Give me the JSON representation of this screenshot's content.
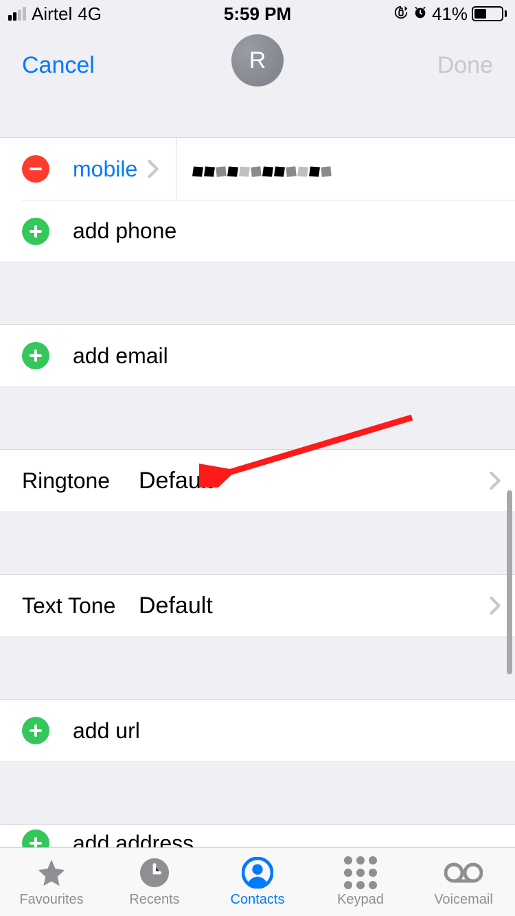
{
  "status": {
    "carrier": "Airtel",
    "network": "4G",
    "time": "5:59 PM",
    "battery_pct": "41%"
  },
  "nav": {
    "cancel": "Cancel",
    "done": "Done",
    "avatar_initial": "R"
  },
  "phone": {
    "type_label": "mobile",
    "value_redacted": ""
  },
  "actions": {
    "add_phone": "add phone",
    "add_email": "add email",
    "add_url": "add url",
    "add_address": "add address"
  },
  "ringtone": {
    "label": "Ringtone",
    "value": "Default"
  },
  "texttone": {
    "label": "Text Tone",
    "value": "Default"
  },
  "tabs": {
    "favourites": "Favourites",
    "recents": "Recents",
    "contacts": "Contacts",
    "keypad": "Keypad",
    "voicemail": "Voicemail"
  }
}
